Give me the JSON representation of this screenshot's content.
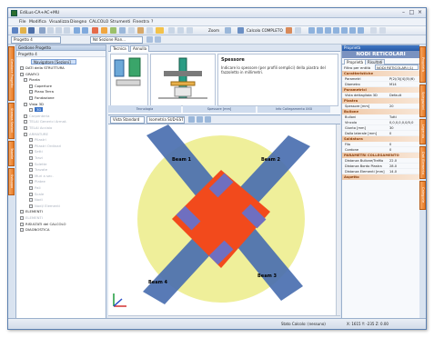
{
  "window": {
    "title": "EdiLus-CA+AC+MU"
  },
  "menu": [
    "File",
    "Modifica",
    "Visualizza",
    "Disegno",
    "CALCOLO",
    "Strumenti",
    "Finestra",
    "?"
  ],
  "toolbar": {
    "zoom_label": "Zoom",
    "calc_label": "Calcolo COMPLETO",
    "project_combo": "Progetto 4",
    "section_combo": "Nd Sezione Pian...",
    "view_label": "Vista Standard",
    "view_combo": "Isometria SUD-EST"
  },
  "left_panel": {
    "header": "Gestione Progetto",
    "combo": "Progetto 4",
    "root_node": "Navigatore [Sezioni]",
    "tree": [
      {
        "label": "DATI della STRUTTURA",
        "dim": false
      },
      {
        "label": "GRAFICI",
        "dim": false
      },
      {
        "label": "Pianta",
        "dim": false
      },
      {
        "label": "Coperture",
        "dim": false
      },
      {
        "label": "Piano Terra",
        "dim": false
      },
      {
        "label": "Fondazione",
        "dim": false
      },
      {
        "label": "Vista 3D",
        "dim": false
      },
      {
        "label": "3D",
        "dim": false
      },
      {
        "label": "Carpenteria",
        "dim": true
      },
      {
        "label": "TELAI Generici Armat.",
        "dim": true
      },
      {
        "label": "TELAI Acciaio",
        "dim": true
      },
      {
        "label": "ARMATURE",
        "dim": true
      },
      {
        "label": "Pilastri",
        "dim": true
      },
      {
        "label": "Pilastri Ordinari",
        "dim": true
      },
      {
        "label": "Setti",
        "dim": true
      },
      {
        "label": "Travi",
        "dim": true
      },
      {
        "label": "Solette",
        "dim": true
      },
      {
        "label": "Travate",
        "dim": true
      },
      {
        "label": "Muri a sec.",
        "dim": true
      },
      {
        "label": "Platee",
        "dim": true
      },
      {
        "label": "Pali",
        "dim": true
      },
      {
        "label": "Scale",
        "dim": true
      },
      {
        "label": "Nodi",
        "dim": true
      },
      {
        "label": "Nodi/ Elementi",
        "dim": true
      },
      {
        "label": "ELEMENTI",
        "dim": false
      },
      {
        "label": "ELEMENTI",
        "dim": true
      },
      {
        "label": "RISULTATI del CALCOLO",
        "dim": false
      },
      {
        "label": "DIAGNOSTICA",
        "dim": false
      }
    ]
  },
  "left_vtabs": [
    "Gestione Progetto",
    "Stampa Sezioni",
    "Tabelle",
    "Sviluppo"
  ],
  "right_vtabs": [
    "Proprietà",
    "Spiegazioni",
    "Legenda",
    "Dati Elemento",
    "Categorie"
  ],
  "center": {
    "tabs": [
      "Tecnica",
      "Annulla"
    ],
    "frame_captions": [
      "Tecnologia",
      "Spessore [mm]",
      "Info Collegamento XXX"
    ],
    "desc_title": "Spessore",
    "desc_body": "Indicare lo spessore (per profili semplici) della piastra del fazzoletto in millimetri.",
    "beams": [
      "Beam 1",
      "Beam 2",
      "Beam 3",
      "Beam 4"
    ]
  },
  "right_panel": {
    "title": "Proprietà",
    "header": "NODI RETICOLARI",
    "tabs": [
      "Proprietà",
      "Risultati"
    ],
    "filter_label": "Filtro per entità",
    "filter_value": "NODI RETICOLARI (1)",
    "sections": [
      {
        "name": "Caratteristiche",
        "rows": [
          [
            "Parametri",
            "P(2)(3)[4](5)(6)"
          ],
          [
            "Diametro",
            "M14"
          ]
        ]
      },
      {
        "name": "Parametrici",
        "rows": [
          [
            "Vista dettagliata 3D",
            "Default"
          ]
        ]
      },
      {
        "name": "Piastra",
        "rows": [
          [
            "Spessore [mm]",
            "20"
          ]
        ]
      },
      {
        "name": "Bullone",
        "rows": [
          [
            "Bulloni",
            "Tutti"
          ],
          [
            "Vincolo",
            "0,0,0,0,0,0/0,0"
          ],
          [
            "Giunto [mm]",
            "30"
          ],
          [
            "Dalla laterale [mm]",
            "0"
          ]
        ]
      },
      {
        "name": "Saldatura",
        "rows": [
          [
            "Filo",
            "0"
          ],
          [
            "Cordone",
            "0"
          ]
        ]
      },
      {
        "name": "PARAMETRI COLLEGAMENTO",
        "rows": [
          [
            "Distanza Bullone/Trafilo",
            "22.0"
          ],
          [
            "Distanza Bordo Piastra",
            "28.0"
          ],
          [
            "Distanza Elementi [mm]",
            "14.0"
          ]
        ]
      },
      {
        "name": "Aspetto",
        "rows": []
      }
    ]
  },
  "status": {
    "left": "Stato Calcolo: (nessuno)",
    "coords": "X: 1615 Y: -235 Z: 0.00"
  },
  "colors": {
    "accent": "#e87a24",
    "beam": "#4a6fb0",
    "plate": "#f24a1c",
    "disc": "#efef9a"
  }
}
